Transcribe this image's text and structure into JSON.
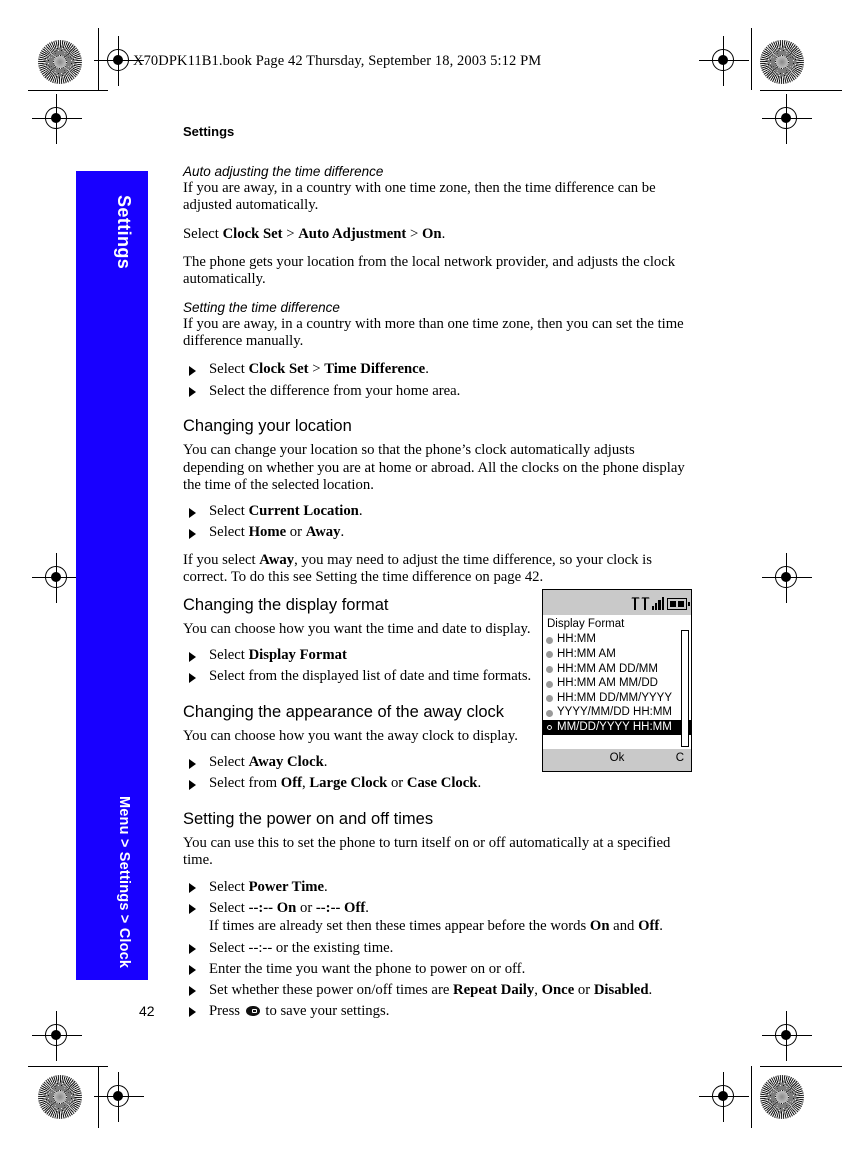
{
  "document": {
    "slug": "X70DPK11B1.book  Page 42  Thursday, September 18, 2003  5:12 PM",
    "page_number": "42",
    "page_title": "Settings",
    "accent_color": "#1800ff"
  },
  "sidetab": {
    "top_label": "Settings",
    "bottom_label": "Menu > Settings > Clock"
  },
  "sections": {
    "auto_adjust": {
      "heading": "Auto adjusting the time difference",
      "para1": "If you are away, in a country with one time zone, then the time difference can be adjusted automatically.",
      "para2_prefix": "Select ",
      "para2_b1": "Clock Set",
      "para2_sep1": " > ",
      "para2_b2": "Auto Adjustment",
      "para2_sep2": " > ",
      "para2_b3": "On",
      "para2_end": ".",
      "para3": "The phone gets your location from the local network provider, and adjusts the clock automatically."
    },
    "setting_time_diff": {
      "heading": "Setting the time difference",
      "para1": "If you are away, in a country with more than one time zone, then you can set the time difference manually.",
      "step1_prefix": "Select ",
      "step1_b1": "Clock Set",
      "step1_sep": " > ",
      "step1_b2": "Time Difference",
      "step1_end": ".",
      "step2": "Select the difference from your home area."
    },
    "changing_location": {
      "heading": "Changing your location",
      "para1": "You can change your location so that the phone’s clock automatically adjusts depending on whether you are at home or abroad. All the clocks on the phone display the time of the selected location.",
      "step1_prefix": "Select ",
      "step1_b1": "Current Location",
      "step1_end": ".",
      "step2_prefix": "Select ",
      "step2_b1": "Home",
      "step2_mid": " or ",
      "step2_b2": "Away",
      "step2_end": ".",
      "para2_prefix": "If you select ",
      "para2_b1": "Away",
      "para2_end": ", you may need to adjust the time difference, so your clock is correct. To do this see Setting the time difference on page 42."
    },
    "display_format": {
      "heading": "Changing the display format",
      "para1": "You can choose how you want the time and date to display.",
      "step1_prefix": "Select ",
      "step1_b1": "Display Format",
      "step2": "Select from the displayed list of date and time formats."
    },
    "away_clock": {
      "heading": "Changing the appearance of the away clock",
      "para1": "You can choose how you want the away clock to display.",
      "step1_prefix": "Select ",
      "step1_b1": "Away Clock",
      "step1_end": ".",
      "step2_prefix": "Select from ",
      "step2_b1": "Off",
      "step2_sep1": ", ",
      "step2_b2": "Large Clock",
      "step2_sep2": " or ",
      "step2_b3": "Case Clock",
      "step2_end": "."
    },
    "power_times": {
      "heading": "Setting the power on and off times",
      "para1": "You can use this to set the phone to turn itself on or off automatically at a specified time.",
      "step1_prefix": "Select ",
      "step1_b1": "Power Time",
      "step1_end": ".",
      "step2_prefix": "Select ",
      "step2_b1": "--:-- On",
      "step2_mid": " or ",
      "step2_b2": "--:-- Off",
      "step2_end": ".",
      "step2_sub_prefix": "If times are already set then these times appear before the words ",
      "step2_sub_b1": "On",
      "step2_sub_mid": " and ",
      "step2_sub_b2": "Off",
      "step2_sub_end": ".",
      "step3": "Select --:-- or the existing time.",
      "step4": "Enter the time you want the phone to power on or off.",
      "step5_prefix": "Set whether these power on/off times are ",
      "step5_b1": "Repeat Daily",
      "step5_sep1": ", ",
      "step5_b2": "Once",
      "step5_sep2": " or ",
      "step5_b3": "Disabled",
      "step5_end": ".",
      "step6_prefix": "Press ",
      "step6_end": " to save your settings."
    }
  },
  "phone_mock": {
    "status_icons": [
      "antenna-icon",
      "antenna-icon",
      "signal-bars-icon",
      "battery-icon"
    ],
    "list_title": "Display Format",
    "options": [
      {
        "label": "HH:MM",
        "selected": false
      },
      {
        "label": "HH:MM AM",
        "selected": false
      },
      {
        "label": "HH:MM AM DD/MM",
        "selected": false
      },
      {
        "label": "HH:MM AM MM/DD",
        "selected": false
      },
      {
        "label": "HH:MM DD/MM/YYYY",
        "selected": false
      },
      {
        "label": "YYYY/MM/DD HH:MM",
        "selected": false
      },
      {
        "label": "MM/DD/YYYY HH:MM",
        "selected": true
      }
    ],
    "softkey_left": "Ok",
    "softkey_right": "C"
  }
}
